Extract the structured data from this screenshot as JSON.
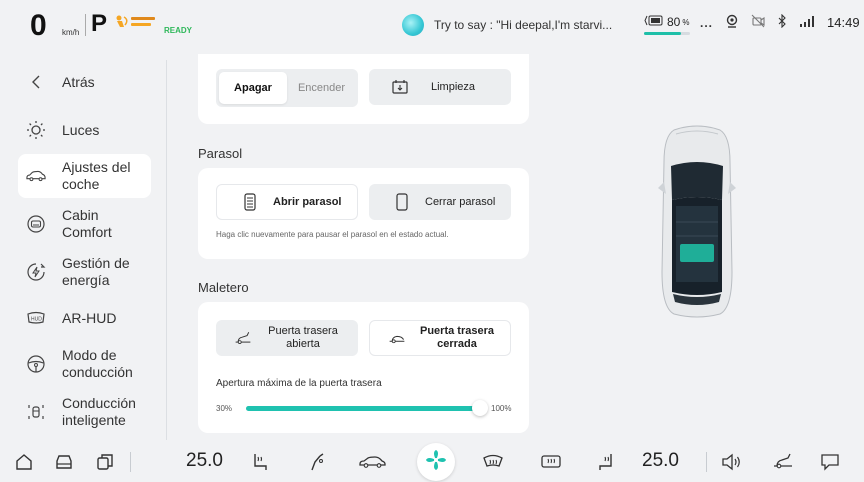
{
  "status": {
    "speed": "0",
    "speed_unit": "km/h",
    "gear": "P",
    "ready": "READY",
    "voice_hint": "Try to say : \"Hi deepal,I'm starvi...",
    "battery_value": "80",
    "battery_unit": "%",
    "battery_level": 0.8,
    "more": "...",
    "time": "14:49"
  },
  "sidebar": {
    "back_label": "Atrás",
    "items": [
      {
        "label": "Luces",
        "icon": "sun-icon"
      },
      {
        "label": "Ajustes del coche",
        "icon": "car-outline-icon",
        "active": true
      },
      {
        "label": "Cabin Comfort",
        "icon": "cabin-icon"
      },
      {
        "label": "Gestión de energía",
        "icon": "energy-icon"
      },
      {
        "label": "AR-HUD",
        "icon": "hud-icon"
      },
      {
        "label": "Modo de conducción",
        "icon": "steering-wheel-icon"
      },
      {
        "label": "Conducción inteligente",
        "icon": "smart-driving-icon"
      }
    ]
  },
  "top_card": {
    "toggle_on": "Apagar",
    "toggle_off": "Encender",
    "clean_label": "Limpieza"
  },
  "parasol": {
    "title": "Parasol",
    "open_label": "Abrir parasol",
    "close_label": "Cerrar parasol",
    "hint": "Haga clic nuevamente para pausar el parasol en el estado actual."
  },
  "maletero": {
    "title": "Maletero",
    "open_label": "Puerta trasera abierta",
    "closed_label": "Puerta trasera cerrada",
    "slider_label": "Apertura máxima de la puerta trasera",
    "slider_min": "30%",
    "slider_max": "100%",
    "slider_value_pct": 100
  },
  "bottom": {
    "temp_left": "25.0",
    "temp_right": "25.0"
  },
  "colors": {
    "accent": "#1fc2b0",
    "ready": "#2fb85a"
  }
}
